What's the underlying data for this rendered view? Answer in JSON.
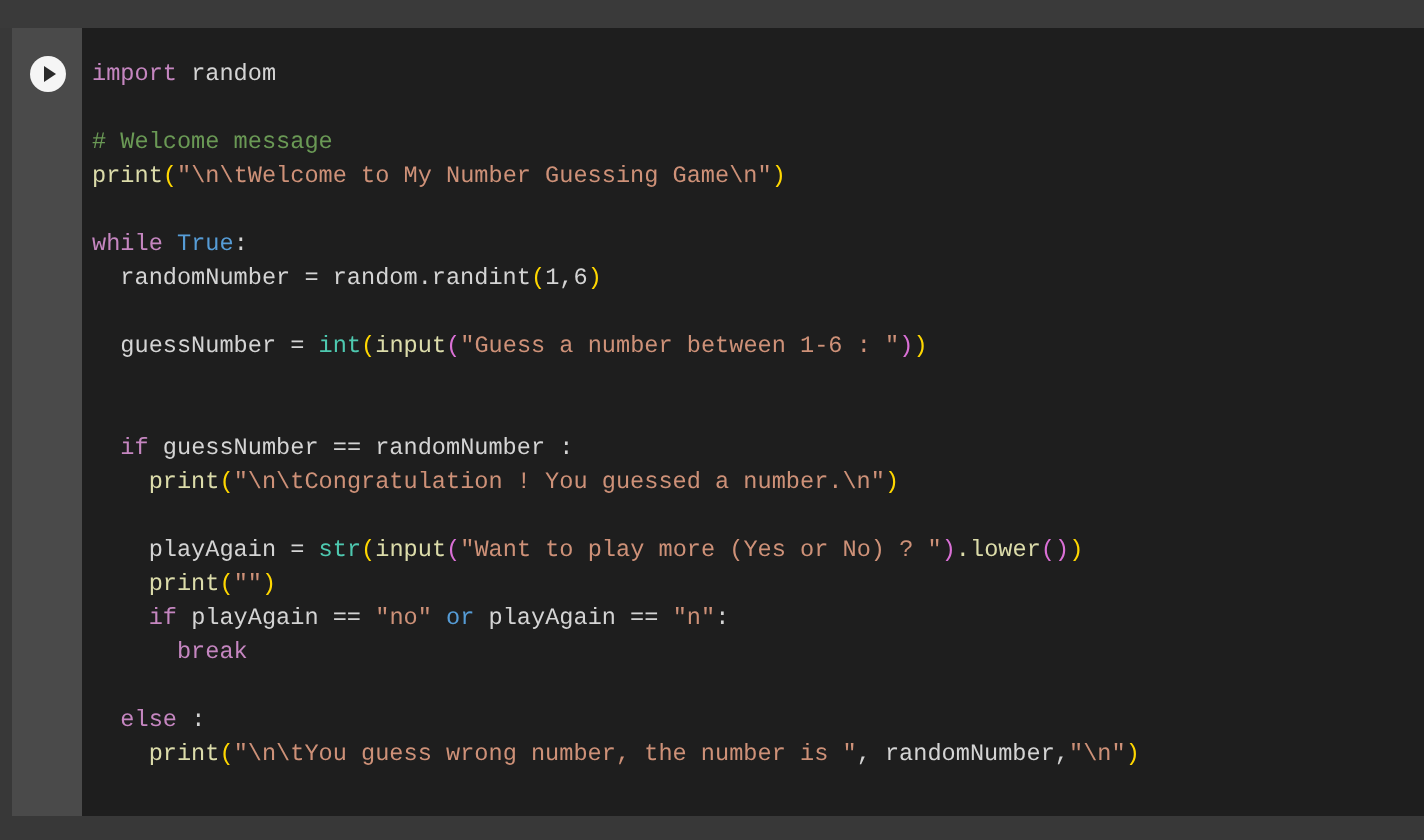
{
  "cell": {
    "lines": [
      {
        "kind": "code",
        "tokens": [
          {
            "text": "import",
            "kind": "keyword"
          },
          {
            "text": " random",
            "kind": "plain"
          }
        ]
      },
      {
        "kind": "blank"
      },
      {
        "kind": "code",
        "tokens": [
          {
            "text": "# Welcome message",
            "kind": "comment"
          }
        ]
      },
      {
        "kind": "code",
        "tokens": [
          {
            "text": "print",
            "kind": "function"
          },
          {
            "text": "(",
            "kind": "bracket1"
          },
          {
            "text": "\"\\n\\tWelcome to My Number Guessing Game\\n\"",
            "kind": "string"
          },
          {
            "text": ")",
            "kind": "bracket1"
          }
        ]
      },
      {
        "kind": "blank"
      },
      {
        "kind": "code",
        "tokens": [
          {
            "text": "while",
            "kind": "keyword"
          },
          {
            "text": " True",
            "kind": "constant"
          },
          {
            "text": ":",
            "kind": "plain"
          }
        ]
      },
      {
        "kind": "code",
        "tokens": [
          {
            "text": "  randomNumber = random.randint",
            "kind": "plain"
          },
          {
            "text": "(",
            "kind": "bracket1"
          },
          {
            "text": "1,6",
            "kind": "plain"
          },
          {
            "text": ")",
            "kind": "bracket1"
          }
        ]
      },
      {
        "kind": "blank"
      },
      {
        "kind": "code",
        "tokens": [
          {
            "text": "  guessNumber = ",
            "kind": "plain"
          },
          {
            "text": "int",
            "kind": "builtin"
          },
          {
            "text": "(",
            "kind": "bracket1"
          },
          {
            "text": "input",
            "kind": "function"
          },
          {
            "text": "(",
            "kind": "bracket2"
          },
          {
            "text": "\"Guess a number between 1-6 : \"",
            "kind": "string"
          },
          {
            "text": ")",
            "kind": "bracket2"
          },
          {
            "text": ")",
            "kind": "bracket1"
          }
        ]
      },
      {
        "kind": "blank"
      },
      {
        "kind": "blank"
      },
      {
        "kind": "code",
        "tokens": [
          {
            "text": "  if",
            "kind": "keyword"
          },
          {
            "text": " guessNumber == randomNumber :",
            "kind": "plain"
          }
        ]
      },
      {
        "kind": "code",
        "tokens": [
          {
            "text": "    print",
            "kind": "function"
          },
          {
            "text": "(",
            "kind": "bracket1"
          },
          {
            "text": "\"\\n\\tCongratulation ! You guessed a number.\\n\"",
            "kind": "string"
          },
          {
            "text": ")",
            "kind": "bracket1"
          }
        ]
      },
      {
        "kind": "blank"
      },
      {
        "kind": "code",
        "tokens": [
          {
            "text": "    playAgain = ",
            "kind": "plain"
          },
          {
            "text": "str",
            "kind": "builtin"
          },
          {
            "text": "(",
            "kind": "bracket1"
          },
          {
            "text": "input",
            "kind": "function"
          },
          {
            "text": "(",
            "kind": "bracket2"
          },
          {
            "text": "\"Want to play more (Yes or No) ? \"",
            "kind": "string"
          },
          {
            "text": ")",
            "kind": "bracket2"
          },
          {
            "text": ".lower",
            "kind": "function"
          },
          {
            "text": "()",
            "kind": "bracket2"
          },
          {
            "text": ")",
            "kind": "bracket1"
          }
        ]
      },
      {
        "kind": "code",
        "tokens": [
          {
            "text": "    print",
            "kind": "function"
          },
          {
            "text": "(",
            "kind": "bracket1"
          },
          {
            "text": "\"\"",
            "kind": "string"
          },
          {
            "text": ")",
            "kind": "bracket1"
          }
        ]
      },
      {
        "kind": "code",
        "tokens": [
          {
            "text": "    if",
            "kind": "keyword"
          },
          {
            "text": " playAgain == ",
            "kind": "plain"
          },
          {
            "text": "\"no\"",
            "kind": "string"
          },
          {
            "text": " or",
            "kind": "constant"
          },
          {
            "text": " playAgain == ",
            "kind": "plain"
          },
          {
            "text": "\"n\"",
            "kind": "string"
          },
          {
            "text": ":",
            "kind": "plain"
          }
        ]
      },
      {
        "kind": "code",
        "tokens": [
          {
            "text": "      break",
            "kind": "keyword"
          }
        ]
      },
      {
        "kind": "blank"
      },
      {
        "kind": "code",
        "tokens": [
          {
            "text": "  else",
            "kind": "keyword"
          },
          {
            "text": " :",
            "kind": "plain"
          }
        ]
      },
      {
        "kind": "code",
        "tokens": [
          {
            "text": "    print",
            "kind": "function"
          },
          {
            "text": "(",
            "kind": "bracket1"
          },
          {
            "text": "\"\\n\\tYou guess wrong number, the number is \"",
            "kind": "string"
          },
          {
            "text": ", randomNumber,",
            "kind": "plain"
          },
          {
            "text": "\"\\n\"",
            "kind": "string"
          },
          {
            "text": ")",
            "kind": "bracket1"
          }
        ]
      }
    ]
  }
}
